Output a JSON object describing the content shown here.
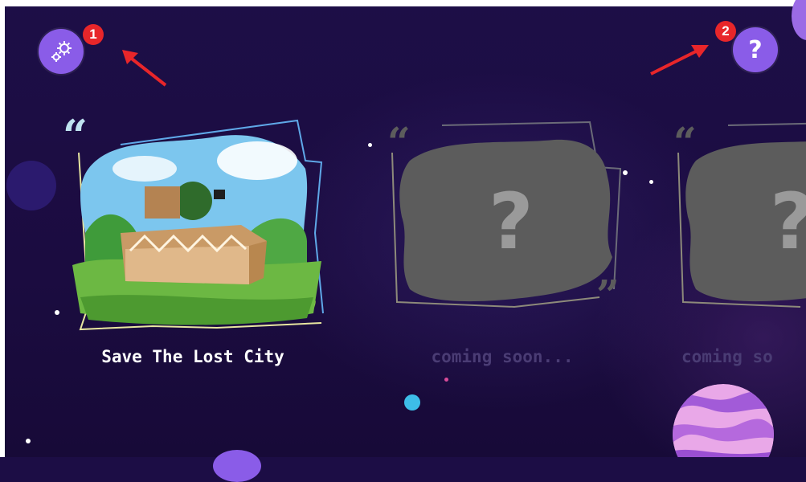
{
  "toolbar": {
    "settings": {
      "icon": "gear-icon",
      "badge": "1"
    },
    "help": {
      "icon": "question-icon",
      "label": "?",
      "badge": "2"
    }
  },
  "cards": [
    {
      "title": "Save The Lost City",
      "locked": false
    },
    {
      "title": "coming soon...",
      "locked": true,
      "placeholder": "?"
    },
    {
      "title": "coming so",
      "locked": true,
      "placeholder": "?"
    }
  ],
  "colors": {
    "background": "#1c0d45",
    "button": "#8a5ce8",
    "badge": "#e8262a",
    "annotation_arrow": "#e8262a",
    "locked_blob": "#5c5c5c",
    "dim_text": "#4a3c74"
  }
}
